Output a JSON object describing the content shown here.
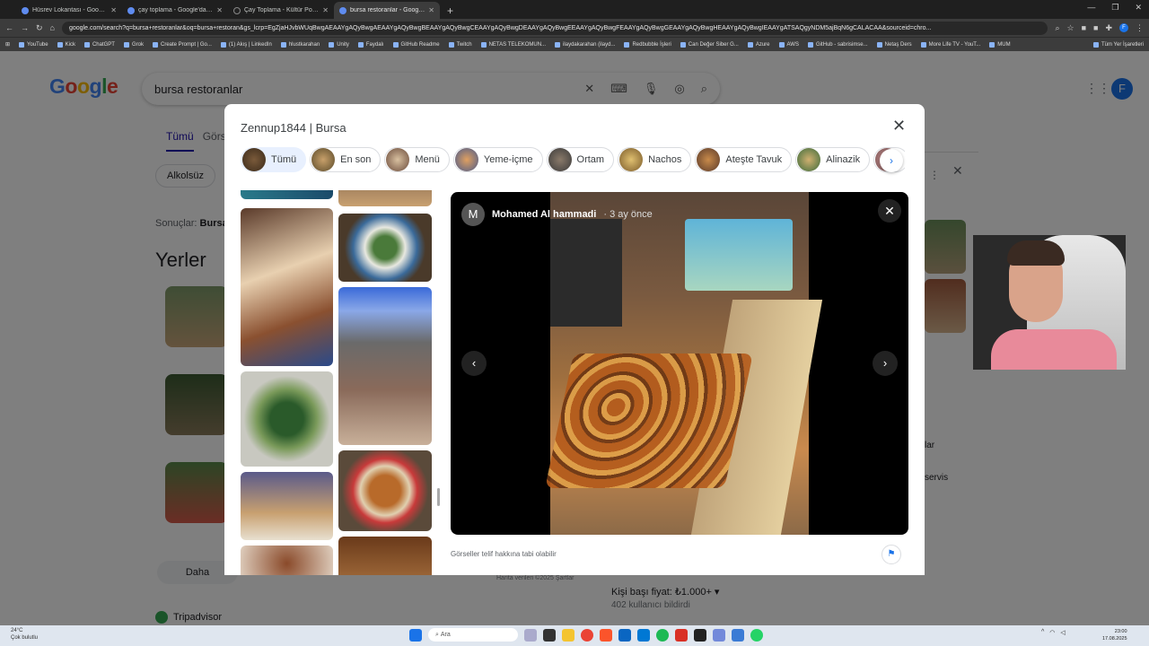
{
  "browser": {
    "tabs": [
      {
        "label": "Hüsrev Lokantası - Google Har"
      },
      {
        "label": "çay toplama - Google'da Ara"
      },
      {
        "label": "Çay Toplama - Kültür Portalı - !"
      },
      {
        "label": "bursa restoranlar - Google'da A",
        "active": true
      }
    ],
    "url": "google.com/search?q=bursa+restoranlar&oq=bursa+restoran&gs_lcrp=EgZjaHJvbWUqBwgAEAAYgAQyBwgAEAAYgAQyBwgBEAAYgAQyBwgCEAAYgAQyBwgDEAAYgAQyBwgEEAAYgAQyBwgFEAAYgAQyBwgGEAAYgAQyBwgHEAAYgAQyBwgIEAAYgATSAQgyNDM5ajBqN6gCALACAA&sourceid=chro...",
    "bookmarks": [
      "YouTube",
      "Kick",
      "ChatGPT",
      "Grok",
      "Create Prompt | Go...",
      "(1) Akış | LinkedIn",
      "hlustkarahan",
      "Unity",
      "Faydalı",
      "GitHub Readme",
      "Twitch",
      "NETAS TELEKOMUN...",
      "ilaydakarahan (ilayd...",
      "Redbubble İşleri",
      "Can Değer Siber G...",
      "Azure",
      "AWS",
      "GitHub - sabrisimse...",
      "Netaş Ders",
      "More Life TV - YouT...",
      "MUM"
    ],
    "bookmarks_all": "Tüm Yer İşaretleri"
  },
  "google": {
    "logo": [
      "G",
      "o",
      "o",
      "g",
      "l",
      "e"
    ],
    "query": "bursa restoranlar",
    "tabs": [
      "Tümü",
      "Görs"
    ],
    "chip": "Alkolsüz",
    "results_prefix": "Sonuçlar:",
    "results_value": "Bursa",
    "section": "Yerler",
    "more_button": "Daha",
    "map_note": "Harita verileri ©2025   Şartlar",
    "tripadvisor": "Tripadvisor",
    "right_text1": "lar",
    "right_text2": "servis",
    "price_label": "Kişi başı fiyat:",
    "price_value": "₺1.000+ ▾",
    "price_count": "402 kullanıcı bildirdi",
    "avatar": "F"
  },
  "modal": {
    "title": "Zennup1844 | Bursa",
    "chips": [
      {
        "label": "Tümü",
        "active": true
      },
      {
        "label": "En son"
      },
      {
        "label": "Menü"
      },
      {
        "label": "Yeme-içme"
      },
      {
        "label": "Ortam"
      },
      {
        "label": "Nachos"
      },
      {
        "label": "Ateşte Tavuk"
      },
      {
        "label": "Alinazik"
      }
    ],
    "author": "Mohamed Al hammadi",
    "author_initial": "M",
    "when": "3 ay önce",
    "copyright": "Görseller telif hakkına tabi olabilir"
  },
  "taskbar": {
    "weather_temp": "24°C",
    "weather_desc": "Çok bulutlu",
    "search": "Ara",
    "time": "23:00",
    "date": "17.08.2025"
  },
  "colors": {
    "accent": "#1a73e8",
    "chip_active": "#e8f0fe",
    "viewer_bg": "#000000"
  }
}
